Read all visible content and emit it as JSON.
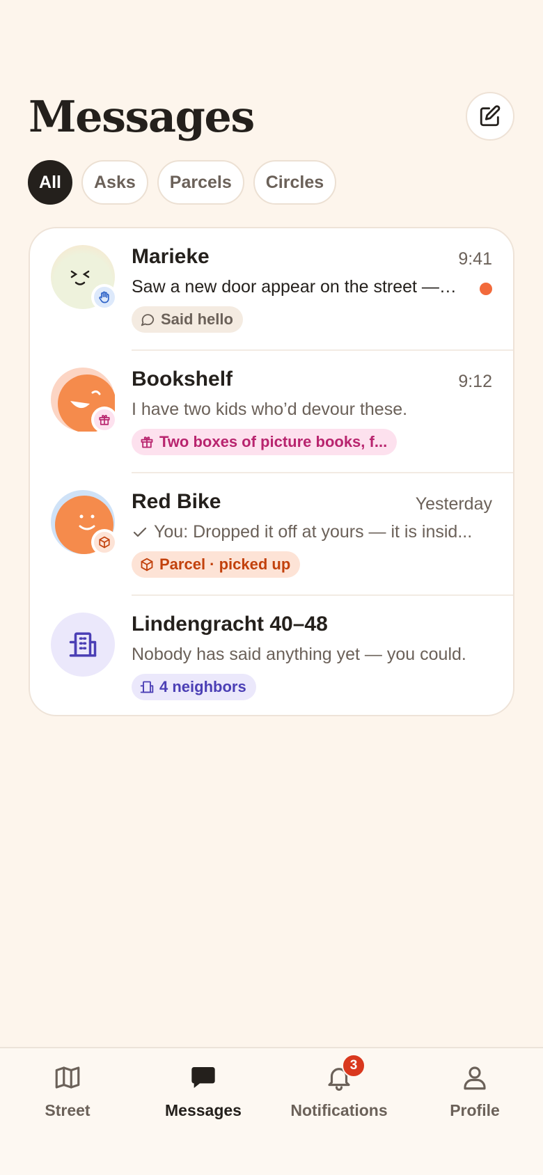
{
  "header": {
    "title": "Messages"
  },
  "filters": [
    {
      "label": "All",
      "active": true
    },
    {
      "label": "Asks",
      "active": false
    },
    {
      "label": "Parcels",
      "active": false
    },
    {
      "label": "Circles",
      "active": false
    }
  ],
  "conversations": [
    {
      "name": "Marieke",
      "time": "9:41",
      "preview": "Saw a new door appear on the street —…",
      "unread": true,
      "tag": "Said hello",
      "tag_icon": "speech-bubble-icon",
      "badge_icon": "wave-hand-icon"
    },
    {
      "name": "Bookshelf",
      "time": "9:12",
      "preview": "I have two kids who’d devour these.",
      "unread": false,
      "tag": "Two boxes of picture books, f...",
      "tag_icon": "gift-icon",
      "badge_icon": "gift-icon"
    },
    {
      "name": "Red Bike",
      "time": "Yesterday",
      "preview": "You: Dropped it off at yours — it is insid...",
      "unread": false,
      "tag": "Parcel · picked up",
      "tag_icon": "package-icon",
      "badge_icon": "package-icon"
    },
    {
      "name": "Lindengracht 40–48",
      "time": "",
      "preview": "Nobody has said anything yet — you could.",
      "unread": false,
      "tag": "4 neighbors",
      "tag_icon": "building-icon",
      "badge_icon": ""
    }
  ],
  "nav": [
    {
      "label": "Street",
      "icon": "map-icon",
      "active": false
    },
    {
      "label": "Messages",
      "icon": "chat-bubble-icon",
      "active": true
    },
    {
      "label": "Notifications",
      "icon": "bell-icon",
      "active": false,
      "badge": "3"
    },
    {
      "label": "Profile",
      "icon": "person-icon",
      "active": false
    }
  ],
  "colors": {
    "background": "#fdf5ec",
    "unread_dot": "#f26a3b",
    "tag_hello_bg": "#f4ebe1",
    "tag_gift_bg": "#fde1ee",
    "tag_gift_text": "#b8246e",
    "tag_parcel_bg": "#fde3d6",
    "tag_parcel_text": "#c2410c",
    "tag_circle_bg": "#ebe8fb",
    "tag_circle_text": "#4b3fb5"
  }
}
